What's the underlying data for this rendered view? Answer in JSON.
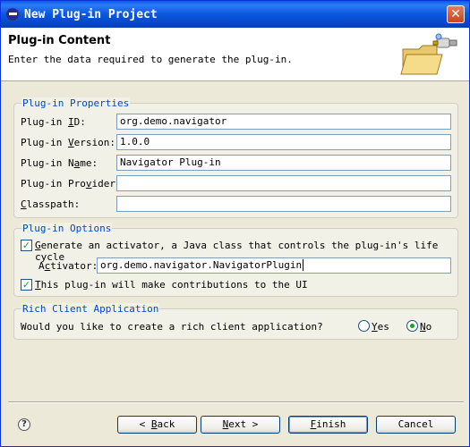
{
  "window": {
    "title": "New Plug-in Project",
    "close_glyph": "✕"
  },
  "header": {
    "title": "Plug-in Content",
    "description": "Enter the data required to generate the plug-in."
  },
  "properties": {
    "legend": "Plug-in Properties",
    "id": {
      "label_pre": "Plug-in ",
      "label_mn": "I",
      "label_post": "D:",
      "value": "org.demo.navigator"
    },
    "version": {
      "label_pre": "Plug-in ",
      "label_mn": "V",
      "label_post": "ersion:",
      "value": "1.0.0"
    },
    "name": {
      "label_pre": "Plug-in N",
      "label_mn": "a",
      "label_post": "me:",
      "value": "Navigator Plug-in"
    },
    "provider": {
      "label_pre": "Plug-in Pro",
      "label_mn": "v",
      "label_post": "ider:",
      "value": ""
    },
    "classpath": {
      "label_pre": "",
      "label_mn": "C",
      "label_post": "lasspath:",
      "value": ""
    }
  },
  "options": {
    "legend": "Plug-in Options",
    "generate_activator": {
      "label_mn": "G",
      "label_post": "enerate an activator, a Java class that controls the plug-in's life cycle",
      "checked": true
    },
    "activator": {
      "label_pre": "A",
      "label_mn": "c",
      "label_post": "tivator:",
      "value": "org.demo.navigator.NavigatorPlugin"
    },
    "ui_contrib": {
      "label_pre": "",
      "label_mn": "T",
      "label_post": "his plug-in will make contributions to the UI",
      "checked": true
    }
  },
  "rcp": {
    "legend": "Rich Client Application",
    "question": "Would you like to create a rich client application?",
    "yes": {
      "label_mn": "Y",
      "label_post": "es",
      "selected": false
    },
    "no": {
      "label_mn": "N",
      "label_post": "o",
      "selected": true
    }
  },
  "buttons": {
    "help_glyph": "?",
    "back": {
      "pre": "< ",
      "mn": "B",
      "post": "ack"
    },
    "next": {
      "pre": "",
      "mn": "N",
      "post": "ext >"
    },
    "finish": {
      "pre": "",
      "mn": "F",
      "post": "inish"
    },
    "cancel": "Cancel"
  },
  "colors": {
    "title_bar": "#0a5ae8",
    "group_legend": "#0046d5",
    "check": "#21a121"
  }
}
